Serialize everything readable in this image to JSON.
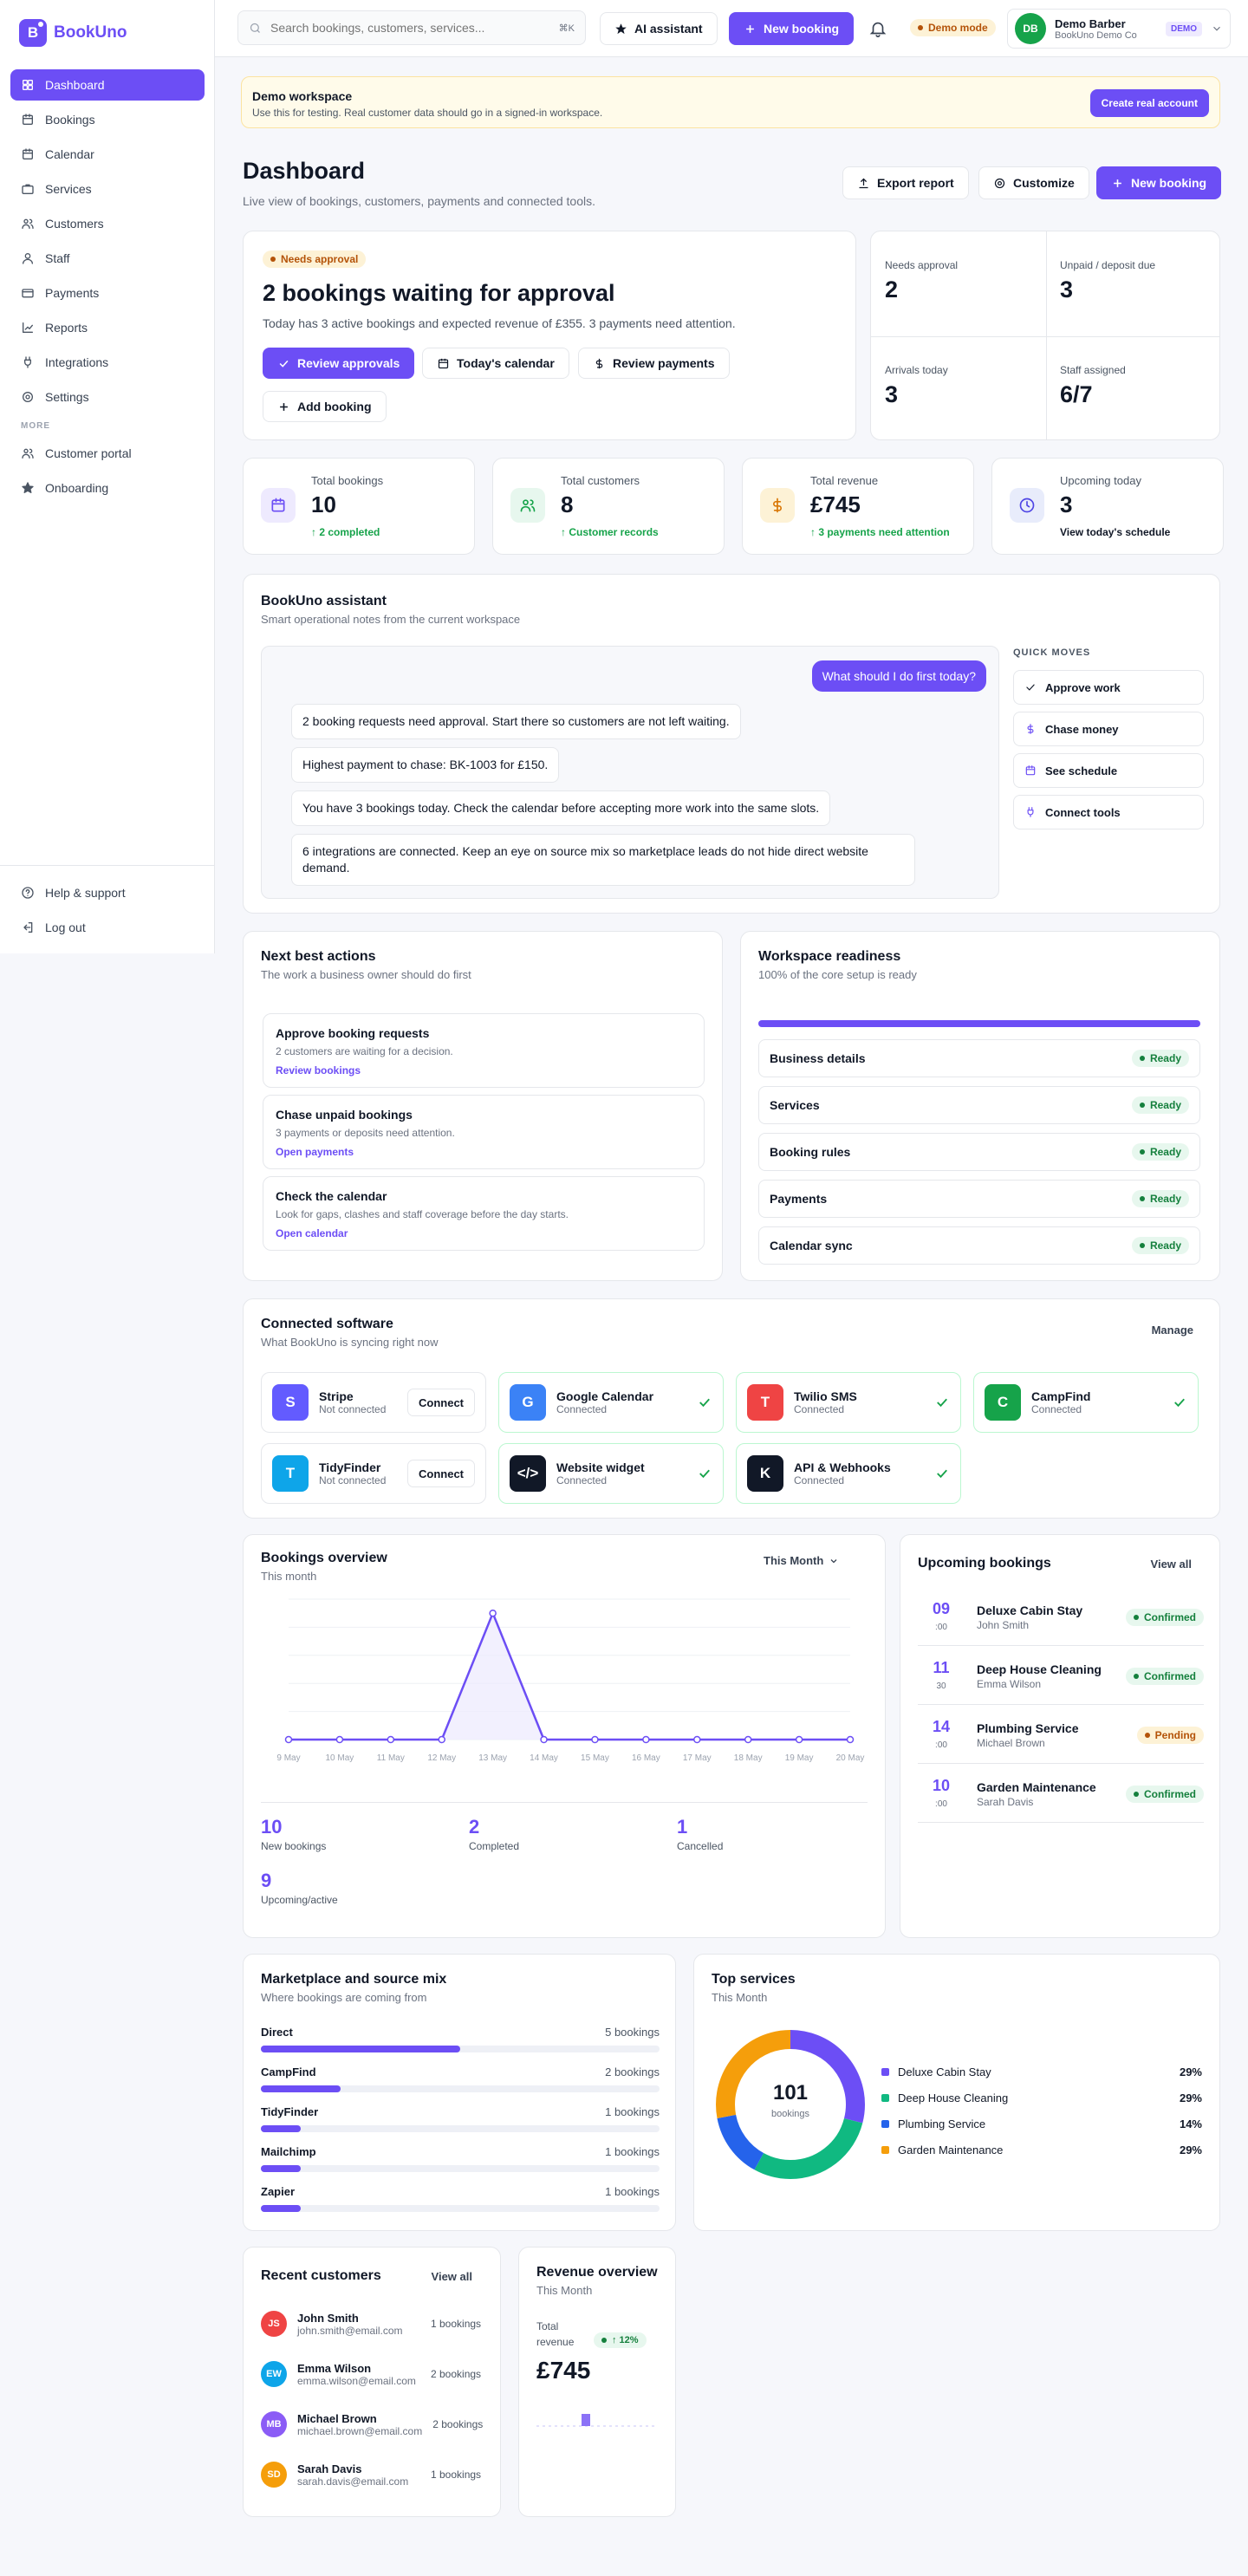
{
  "brand": {
    "name": "BookUno",
    "mark": "B"
  },
  "sidebar": {
    "items": [
      {
        "label": "Dashboard",
        "icon": "grid-icon",
        "active": true
      },
      {
        "label": "Bookings",
        "icon": "calendar-icon"
      },
      {
        "label": "Calendar",
        "icon": "calendar-icon"
      },
      {
        "label": "Services",
        "icon": "briefcase-icon"
      },
      {
        "label": "Customers",
        "icon": "users-icon"
      },
      {
        "label": "Staff",
        "icon": "user-icon"
      },
      {
        "label": "Payments",
        "icon": "card-icon"
      },
      {
        "label": "Reports",
        "icon": "chart-icon"
      },
      {
        "label": "Integrations",
        "icon": "plug-icon"
      },
      {
        "label": "Settings",
        "icon": "gear-icon"
      }
    ],
    "more_label": "MORE",
    "more_items": [
      {
        "label": "Customer portal",
        "icon": "users-icon"
      },
      {
        "label": "Onboarding",
        "icon": "star-icon"
      }
    ],
    "footer": [
      {
        "label": "Help & support",
        "icon": "help-icon"
      },
      {
        "label": "Log out",
        "icon": "logout-icon"
      }
    ]
  },
  "topbar": {
    "search_placeholder": "Search bookings, customers, services...",
    "search_shortcut": "⌘K",
    "ai_label": "AI assistant",
    "new_booking_label": "New booking",
    "demo_mode": "Demo mode",
    "user": {
      "initials": "DB",
      "name": "Demo Barber",
      "org": "BookUno Demo Co",
      "badge": "DEMO"
    }
  },
  "banner": {
    "title": "Demo workspace",
    "text": "Use this for testing. Real customer data should go in a signed-in workspace.",
    "button": "Create real account"
  },
  "page": {
    "title": "Dashboard",
    "subtitle": "Live view of bookings, customers, payments and connected tools.",
    "export": "Export report",
    "customize": "Customize",
    "new_booking": "New booking"
  },
  "approval": {
    "badge": "Needs approval",
    "title": "2 bookings waiting for approval",
    "text": "Today has 3 active bookings and expected revenue of £355. 3 payments need attention.",
    "btn_review": "Review approvals",
    "btn_calendar": "Today's calendar",
    "btn_payments": "Review payments",
    "btn_add": "Add booking"
  },
  "mini_stats": [
    {
      "label": "Needs approval",
      "value": "2"
    },
    {
      "label": "Unpaid / deposit due",
      "value": "3"
    },
    {
      "label": "Arrivals today",
      "value": "3"
    },
    {
      "label": "Staff assigned",
      "value": "6/7"
    }
  ],
  "kpis": [
    {
      "label": "Total bookings",
      "value": "10",
      "meta": "↑ 2 completed",
      "icon": "calendar-icon",
      "bg": "#eeeafe",
      "fg": "#6c4ef5",
      "meta_color": "#16a34a"
    },
    {
      "label": "Total customers",
      "value": "8",
      "meta": "↑ Customer records",
      "icon": "users-icon",
      "bg": "#e7f7ee",
      "fg": "#16a34a",
      "meta_color": "#16a34a"
    },
    {
      "label": "Total revenue",
      "value": "£745",
      "meta": "↑ 3 payments need attention",
      "icon": "dollar-icon",
      "bg": "#fdf2d6",
      "fg": "#d97706",
      "meta_color": "#16a34a"
    },
    {
      "label": "Upcoming today",
      "value": "3",
      "meta": "View today's schedule",
      "icon": "clock-icon",
      "bg": "#e8ecfb",
      "fg": "#4f46e5",
      "meta_color": "#111827"
    }
  ],
  "assistant": {
    "title": "BookUno assistant",
    "subtitle": "Smart operational notes from the current workspace",
    "user_msg": "What should I do first today?",
    "replies": [
      "2 booking requests need approval. Start there so customers are not left waiting.",
      "Highest payment to chase: BK-1003 for £150.",
      "You have 3 bookings today. Check the calendar before accepting more work into the same slots.",
      "6 integrations are connected. Keep an eye on source mix so marketplace leads do not hide direct website demand."
    ],
    "quick_title": "QUICK MOVES",
    "quick": [
      {
        "label": "Approve work",
        "icon": "check-icon"
      },
      {
        "label": "Chase money",
        "icon": "dollar-icon"
      },
      {
        "label": "See schedule",
        "icon": "calendar-icon"
      },
      {
        "label": "Connect tools",
        "icon": "plug-icon"
      }
    ]
  },
  "next_actions": {
    "title": "Next best actions",
    "subtitle": "The work a business owner should do first",
    "items": [
      {
        "title": "Approve booking requests",
        "desc": "2 customers are waiting for a decision.",
        "link": "Review bookings"
      },
      {
        "title": "Chase unpaid bookings",
        "desc": "3 payments or deposits need attention.",
        "link": "Open payments"
      },
      {
        "title": "Check the calendar",
        "desc": "Look for gaps, clashes and staff coverage before the day starts.",
        "link": "Open calendar"
      }
    ]
  },
  "readiness": {
    "title": "Workspace readiness",
    "subtitle": "100% of the core setup is ready",
    "progress": 1,
    "items": [
      {
        "label": "Business details",
        "status": "Ready"
      },
      {
        "label": "Services",
        "status": "Ready"
      },
      {
        "label": "Booking rules",
        "status": "Ready"
      },
      {
        "label": "Payments",
        "status": "Ready"
      },
      {
        "label": "Calendar sync",
        "status": "Ready"
      }
    ]
  },
  "software": {
    "title": "Connected software",
    "subtitle": "What BookUno is syncing right now",
    "manage": "Manage",
    "connect_label": "Connect",
    "items": [
      {
        "name": "Stripe",
        "status": "Not connected",
        "letter": "S",
        "color": "#635bff",
        "connected": false
      },
      {
        "name": "Google Calendar",
        "status": "Connected",
        "letter": "G",
        "color": "#3b82f6",
        "connected": true
      },
      {
        "name": "Twilio SMS",
        "status": "Connected",
        "letter": "T",
        "color": "#ef4444",
        "connected": true
      },
      {
        "name": "CampFind",
        "status": "Connected",
        "letter": "C",
        "color": "#16a34a",
        "connected": true
      },
      {
        "name": "TidyFinder",
        "status": "Not connected",
        "letter": "T",
        "color": "#0ea5e9",
        "connected": false
      },
      {
        "name": "Website widget",
        "status": "Connected",
        "letter": "</>",
        "color": "#111827",
        "connected": true
      },
      {
        "name": "API & Webhooks",
        "status": "Connected",
        "letter": "K",
        "color": "#111827",
        "connected": true
      }
    ]
  },
  "overview": {
    "title": "Bookings overview",
    "subtitle": "This month",
    "period": "This Month",
    "stats": [
      {
        "value": "10",
        "label": "New bookings"
      },
      {
        "value": "2",
        "label": "Completed"
      },
      {
        "value": "1",
        "label": "Cancelled"
      },
      {
        "value": "9",
        "label": "Upcoming/active"
      }
    ]
  },
  "chart_data": {
    "type": "line",
    "x": [
      "9 May",
      "10 May",
      "11 May",
      "12 May",
      "13 May",
      "14 May",
      "15 May",
      "16 May",
      "17 May",
      "18 May",
      "19 May",
      "20 May"
    ],
    "series": [
      {
        "values": [
          0,
          0,
          0,
          0,
          9,
          0,
          0,
          0,
          0,
          0,
          0,
          0
        ]
      }
    ],
    "ylim": [
      0,
      10
    ],
    "grid": true
  },
  "upcoming": {
    "title": "Upcoming bookings",
    "view_all": "View all",
    "items": [
      {
        "day": "09",
        "time": ":00",
        "service": "Deluxe Cabin Stay",
        "customer": "John Smith",
        "status": "Confirmed",
        "kind": "green"
      },
      {
        "day": "11",
        "time": "30",
        "service": "Deep House Cleaning",
        "customer": "Emma Wilson",
        "status": "Confirmed",
        "kind": "green"
      },
      {
        "day": "14",
        "time": ":00",
        "service": "Plumbing Service",
        "customer": "Michael Brown",
        "status": "Pending",
        "kind": "yellow"
      },
      {
        "day": "10",
        "time": ":00",
        "service": "Garden Maintenance",
        "customer": "Sarah Davis",
        "status": "Confirmed",
        "kind": "green"
      }
    ]
  },
  "sources": {
    "title": "Marketplace and source mix",
    "subtitle": "Where bookings are coming from",
    "items": [
      {
        "name": "Direct",
        "count": "5 bookings",
        "share": 0.5
      },
      {
        "name": "CampFind",
        "count": "2 bookings",
        "share": 0.2
      },
      {
        "name": "TidyFinder",
        "count": "1 bookings",
        "share": 0.1
      },
      {
        "name": "Mailchimp",
        "count": "1 bookings",
        "share": 0.1
      },
      {
        "name": "Zapier",
        "count": "1 bookings",
        "share": 0.1
      }
    ]
  },
  "top_services": {
    "title": "Top services",
    "subtitle": "This Month",
    "total": "101",
    "total_label": "bookings",
    "items": [
      {
        "name": "Deluxe Cabin Stay",
        "pct": "29%",
        "share": 0.29,
        "color": "#6c4ef5"
      },
      {
        "name": "Deep House Cleaning",
        "pct": "29%",
        "share": 0.29,
        "color": "#10b981"
      },
      {
        "name": "Plumbing Service",
        "pct": "14%",
        "share": 0.14,
        "color": "#2563eb"
      },
      {
        "name": "Garden Maintenance",
        "pct": "29%",
        "share": 0.28,
        "color": "#f59e0b"
      }
    ]
  },
  "recent_customers": {
    "title": "Recent customers",
    "view_all": "View all",
    "items": [
      {
        "initials": "JS",
        "name": "John Smith",
        "email": "john.smith@email.com",
        "count": "1 bookings",
        "color": "#ef4444"
      },
      {
        "initials": "EW",
        "name": "Emma Wilson",
        "email": "emma.wilson@email.com",
        "count": "2 bookings",
        "color": "#0ea5e9"
      },
      {
        "initials": "MB",
        "name": "Michael Brown",
        "email": "michael.brown@email.com",
        "count": "2 bookings",
        "color": "#8b5cf6"
      },
      {
        "initials": "SD",
        "name": "Sarah Davis",
        "email": "sarah.davis@email.com",
        "count": "1 bookings",
        "color": "#f59e0b"
      }
    ]
  },
  "revenue": {
    "title": "Revenue overview",
    "subtitle": "This Month",
    "label": "Total revenue",
    "value": "£745",
    "change": "↑ 12%"
  }
}
